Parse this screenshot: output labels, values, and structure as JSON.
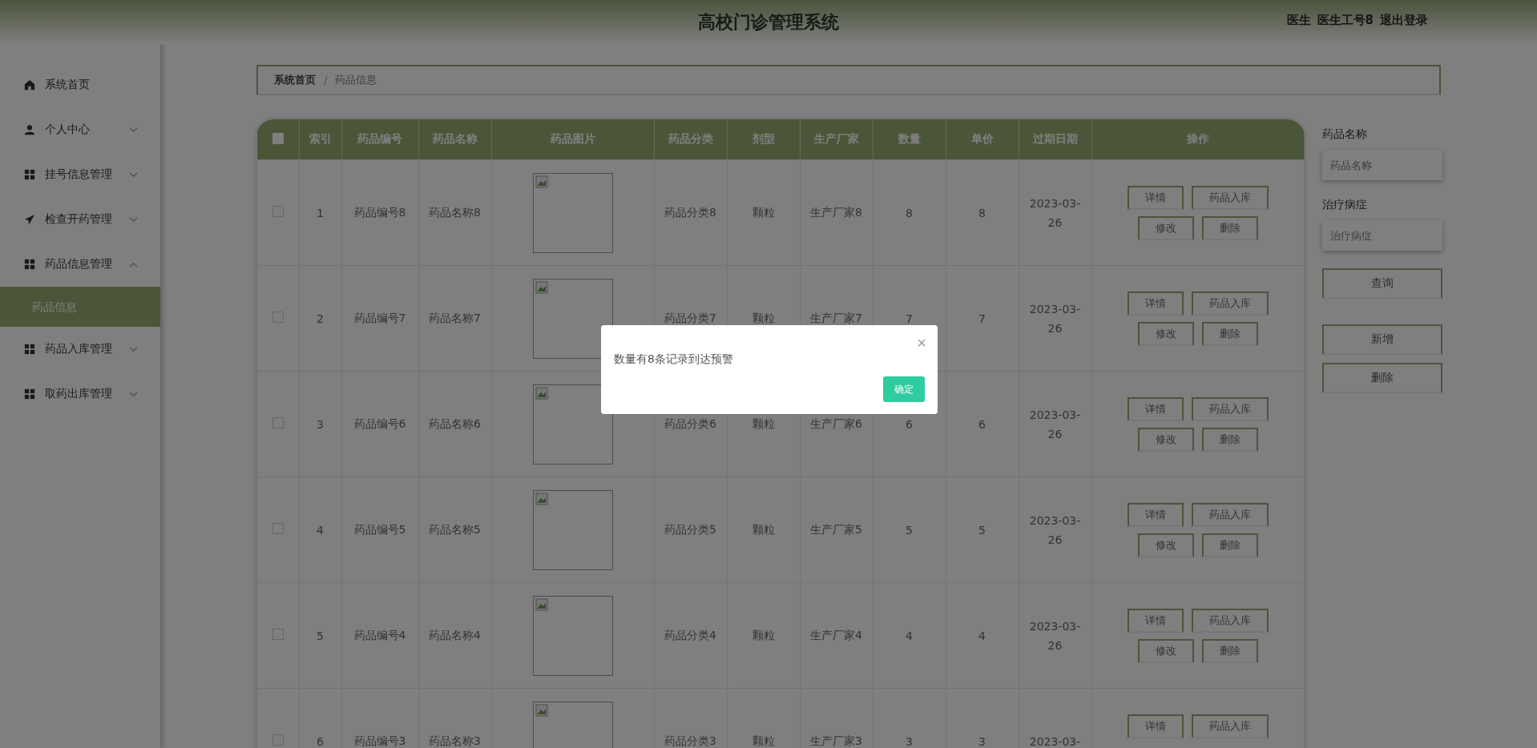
{
  "header": {
    "title": "高校门诊管理系统",
    "role": "医生",
    "user": "医生工号8",
    "logout": "退出登录"
  },
  "sidebar": {
    "items": [
      {
        "label": "系统首页",
        "kind": "link"
      },
      {
        "label": "个人中心",
        "kind": "menu",
        "expanded": false
      },
      {
        "label": "挂号信息管理",
        "kind": "menu",
        "expanded": false
      },
      {
        "label": "检查开药管理",
        "kind": "menu",
        "expanded": false
      },
      {
        "label": "药品信息管理",
        "kind": "menu",
        "expanded": true,
        "children": [
          {
            "label": "药品信息",
            "selected": true
          }
        ]
      },
      {
        "label": "药品入库管理",
        "kind": "menu",
        "expanded": false
      },
      {
        "label": "取药出库管理",
        "kind": "menu",
        "expanded": false
      }
    ]
  },
  "breadcrumb": [
    "系统首页",
    "/",
    "药品信息"
  ],
  "table": {
    "select_all_checked": false,
    "columns": [
      "索引",
      "药品编号",
      "药品名称",
      "药品图片",
      "药品分类",
      "剂型",
      "生产厂家",
      "数量",
      "单价",
      "过期日期",
      "操作"
    ],
    "rows": [
      {
        "checked": false,
        "cells": [
          "1",
          "药品编号8",
          "药品名称8",
          "",
          "药品分类8",
          "颗粒",
          "生产厂家8",
          "8",
          "8",
          "2023-03-26"
        ],
        "actions": [
          "详情",
          "药品入库",
          "修改",
          "删除"
        ]
      },
      {
        "checked": false,
        "cells": [
          "2",
          "药品编号7",
          "药品名称7",
          "",
          "药品分类7",
          "颗粒",
          "生产厂家7",
          "7",
          "7",
          "2023-03-26"
        ],
        "actions": [
          "详情",
          "药品入库",
          "修改",
          "删除"
        ]
      },
      {
        "checked": false,
        "cells": [
          "3",
          "药品编号6",
          "药品名称6",
          "",
          "药品分类6",
          "颗粒",
          "生产厂家6",
          "6",
          "6",
          "2023-03-26"
        ],
        "actions": [
          "详情",
          "药品入库",
          "修改",
          "删除"
        ]
      },
      {
        "checked": false,
        "cells": [
          "4",
          "药品编号5",
          "药品名称5",
          "",
          "药品分类5",
          "颗粒",
          "生产厂家5",
          "5",
          "5",
          "2023-03-26"
        ],
        "actions": [
          "详情",
          "药品入库",
          "修改",
          "删除"
        ]
      },
      {
        "checked": false,
        "cells": [
          "5",
          "药品编号4",
          "药品名称4",
          "",
          "药品分类4",
          "颗粒",
          "生产厂家4",
          "4",
          "4",
          "2023-03-26"
        ],
        "actions": [
          "详情",
          "药品入库",
          "修改",
          "删除"
        ]
      },
      {
        "checked": false,
        "cells": [
          "6",
          "药品编号3",
          "药品名称3",
          "",
          "药品分类3",
          "颗粒",
          "生产厂家3",
          "3",
          "3",
          "2023-03-"
        ],
        "actions": [
          "详情",
          "药品入库"
        ]
      }
    ]
  },
  "search": {
    "fields": [
      {
        "label": "药品名称",
        "placeholder": "药品名称"
      },
      {
        "label": "治疗病症",
        "placeholder": "治疗病症"
      }
    ],
    "query": "查询",
    "add": "新增",
    "delete": "删除"
  },
  "dialog": {
    "message": "数量有8条记录到达预警",
    "confirm": "确定",
    "close": "×"
  }
}
